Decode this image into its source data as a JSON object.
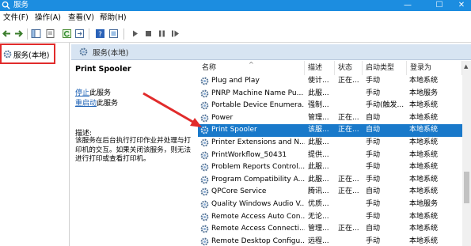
{
  "window": {
    "title": "服务",
    "controls": {
      "minimize": "—",
      "maximize": "☐",
      "close": "✕"
    }
  },
  "menu": [
    "文件(F)",
    "操作(A)",
    "查看(V)",
    "帮助(H)"
  ],
  "tree": {
    "root_label": "服务(本地)"
  },
  "detail_header": {
    "label": "服务(本地)"
  },
  "description_pane": {
    "service_title": "Print Spooler",
    "stop_link": "停止",
    "stop_suffix": "此服务",
    "restart_link": "重启动",
    "restart_suffix": "此服务",
    "desc_label": "描述:",
    "desc_text": "该服务在后台执行打印作业并处理与打印机的交互。如果关闭该服务，则无法进行打印或查看打印机。"
  },
  "columns": [
    "名称",
    "描述",
    "状态",
    "启动类型",
    "登录为"
  ],
  "services": [
    {
      "name": "Plug and Play",
      "desc": "使计...",
      "status": "正在...",
      "start": "手动",
      "logon": "本地系统"
    },
    {
      "name": "PNRP Machine Name Pu...",
      "desc": "此服...",
      "status": "",
      "start": "手动",
      "logon": "本地服务"
    },
    {
      "name": "Portable Device Enumera...",
      "desc": "强制...",
      "status": "",
      "start": "手动(触发...",
      "logon": "本地系统"
    },
    {
      "name": "Power",
      "desc": "管理...",
      "status": "正在...",
      "start": "自动",
      "logon": "本地系统"
    },
    {
      "name": "Print Spooler",
      "desc": "该服...",
      "status": "正在...",
      "start": "自动",
      "logon": "本地系统",
      "selected": true
    },
    {
      "name": "Printer Extensions and N...",
      "desc": "此服...",
      "status": "",
      "start": "手动",
      "logon": "本地系统"
    },
    {
      "name": "PrintWorkflow_50431",
      "desc": "提供...",
      "status": "",
      "start": "手动",
      "logon": "本地系统"
    },
    {
      "name": "Problem Reports Control...",
      "desc": "此服...",
      "status": "",
      "start": "手动",
      "logon": "本地系统"
    },
    {
      "name": "Program Compatibility A...",
      "desc": "此服...",
      "status": "正在...",
      "start": "手动",
      "logon": "本地系统"
    },
    {
      "name": "QPCore Service",
      "desc": "腾讯...",
      "status": "正在...",
      "start": "自动",
      "logon": "本地系统"
    },
    {
      "name": "Quality Windows Audio V...",
      "desc": "优质...",
      "status": "",
      "start": "手动",
      "logon": "本地服务"
    },
    {
      "name": "Remote Access Auto Con...",
      "desc": "无论...",
      "status": "",
      "start": "手动",
      "logon": "本地系统"
    },
    {
      "name": "Remote Access Connecti...",
      "desc": "管理...",
      "status": "正在...",
      "start": "自动",
      "logon": "本地系统"
    },
    {
      "name": "Remote Desktop Configu...",
      "desc": "远程...",
      "status": "",
      "start": "手动",
      "logon": "本地系统"
    }
  ],
  "colors": {
    "titlebar": "#1c8de0",
    "selection": "#1979ca",
    "annotation_red": "#e12b2b",
    "header_bg": "#d7e4f2",
    "link": "#1a5fb4"
  },
  "icons": [
    "services-app-icon",
    "back-arrow-icon",
    "forward-arrow-icon",
    "console-tree-icon",
    "properties-icon",
    "refresh-icon",
    "export-icon",
    "help-icon",
    "view-icon",
    "play-icon",
    "stop-icon",
    "pause-icon",
    "restart-icon",
    "gear-icon"
  ]
}
